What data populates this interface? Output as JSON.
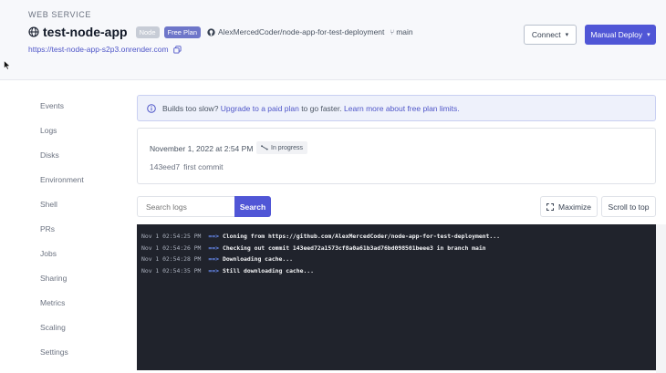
{
  "header": {
    "eyebrow": "WEB SERVICE",
    "service_name": "test-node-app",
    "badges": {
      "runtime": "Node",
      "plan": "Free Plan"
    },
    "repo": "AlexMercedCoder/node-app-for-test-deployment",
    "branch": "main",
    "url": "https://test-node-app-s2p3.onrender.com",
    "connect_label": "Connect",
    "deploy_label": "Manual Deploy"
  },
  "sidebar": {
    "items": [
      {
        "label": "Events"
      },
      {
        "label": "Logs"
      },
      {
        "label": "Disks"
      },
      {
        "label": "Environment"
      },
      {
        "label": "Shell"
      },
      {
        "label": "PRs"
      },
      {
        "label": "Jobs"
      },
      {
        "label": "Sharing"
      },
      {
        "label": "Metrics"
      },
      {
        "label": "Scaling"
      },
      {
        "label": "Settings"
      }
    ]
  },
  "banner": {
    "prefix": "Builds too slow?",
    "link1": "Upgrade to a paid plan",
    "middle": "to go faster.",
    "link2": "Learn more about free plan limits."
  },
  "deploy": {
    "date": "November 1, 2022 at 2:54 PM",
    "status": "In progress",
    "commit_hash": "143eed7",
    "commit_message": "first commit"
  },
  "logs": {
    "search_placeholder": "Search logs",
    "search_button": "Search",
    "maximize_label": "Maximize",
    "scroll_top_label": "Scroll to top",
    "arrow": "==>",
    "lines": [
      {
        "ts": "Nov 1 02:54:25 PM",
        "msg": "Cloning from https://github.com/AlexMercedCoder/node-app-for-test-deployment..."
      },
      {
        "ts": "Nov 1 02:54:26 PM",
        "msg": "Checking out commit 143eed72a1573cf8a0a61b3ad76bd098501beee3 in branch main"
      },
      {
        "ts": "Nov 1 02:54:28 PM",
        "msg": "Downloading cache..."
      },
      {
        "ts": "Nov 1 02:54:35 PM",
        "msg": "Still downloading cache..."
      }
    ]
  },
  "colors": {
    "accent": "#5056d6",
    "link": "#4f56c8",
    "console_bg": "#20232c",
    "arrow": "#6a8ef7"
  },
  "icons": {
    "service": "globe-icon",
    "repo": "github-icon",
    "branch": "branch-icon",
    "copy": "copy-icon",
    "info": "info-icon",
    "status": "in-progress-icon",
    "maximize": "maximize-icon",
    "dropdown": "chevron-down-icon"
  }
}
